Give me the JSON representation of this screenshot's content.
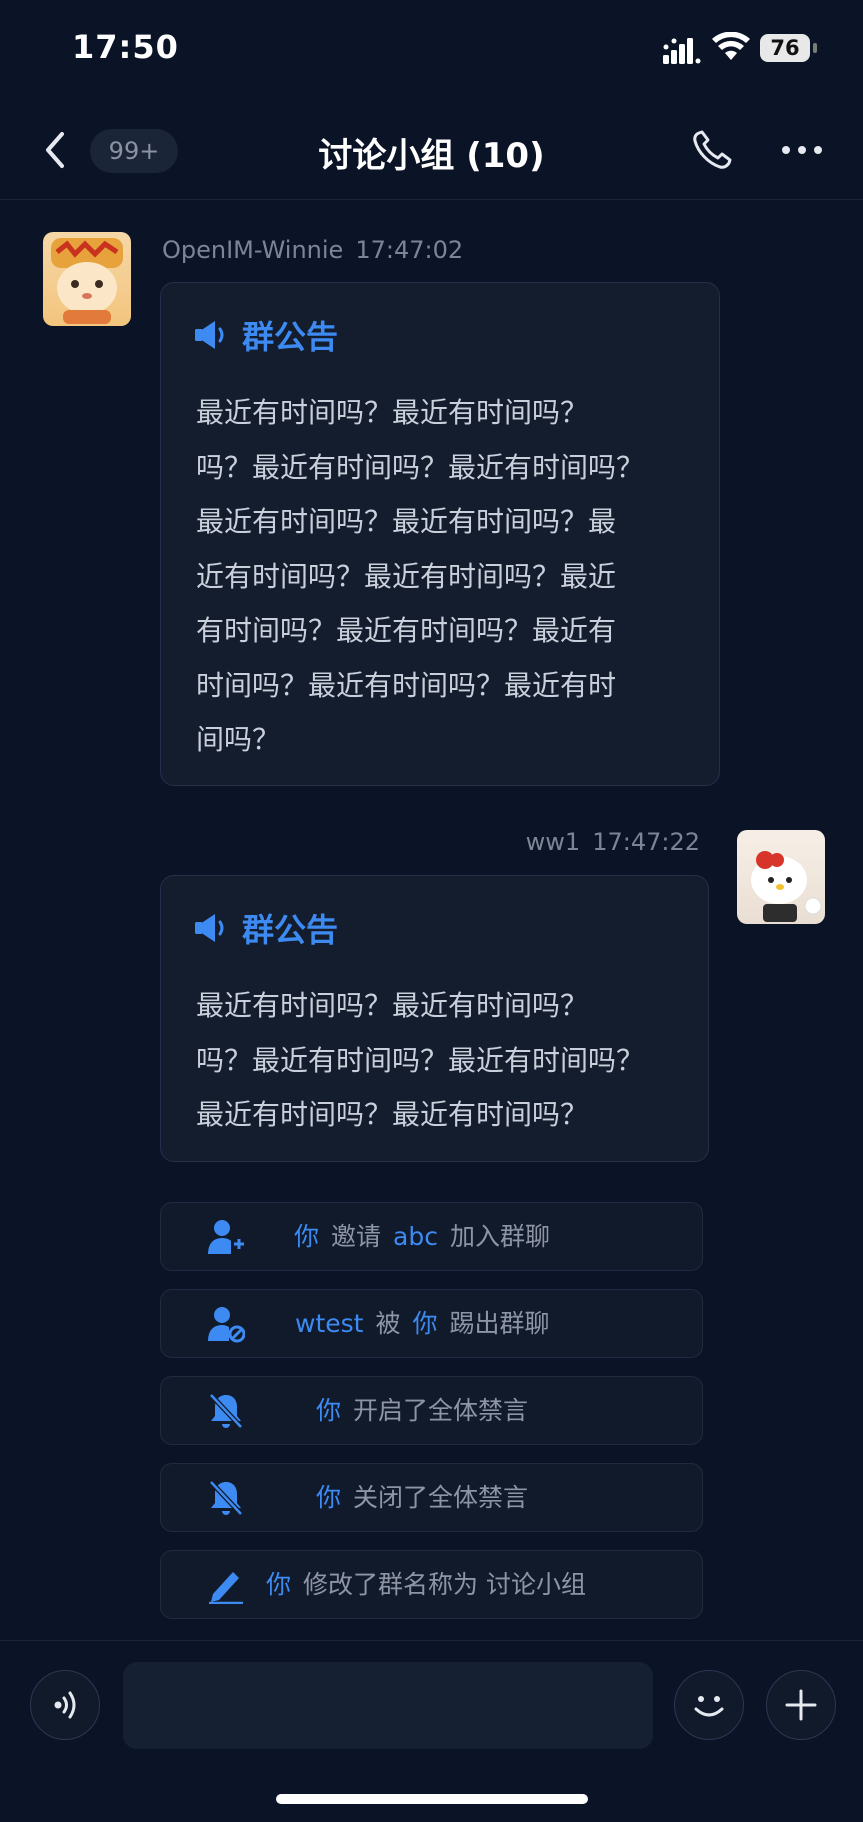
{
  "status_bar": {
    "time": "17:50",
    "battery": "76"
  },
  "nav": {
    "unread_badge": "99+",
    "title": "讨论小组 (10)"
  },
  "messages": [
    {
      "sender": "OpenIM-Winnie",
      "time": "17:47:02",
      "notice_label": "群公告",
      "notice_text": "最近有时间吗？最近有时间吗？\n吗？最近有时间吗？最近有时间吗？\n最近有时间吗？最近有时间吗？最\n近有时间吗？最近有时间吗？最近\n有时间吗？最近有时间吗？最近有\n时间吗？最近有时间吗？最近有时\n间吗？"
    },
    {
      "sender": "ww1",
      "time": "17:47:22",
      "notice_label": "群公告",
      "notice_text": "最近有时间吗？最近有时间吗？\n吗？最近有时间吗？最近有时间吗？\n最近有时间吗？最近有时间吗？"
    }
  ],
  "system_notices": [
    {
      "icon": "user-add-icon",
      "actor": "你",
      "verb": "邀请",
      "target": "abc",
      "suffix": "加入群聊"
    },
    {
      "icon": "user-remove-icon",
      "actor": "wtest",
      "verb": "被",
      "target": "你",
      "suffix": "踢出群聊"
    },
    {
      "icon": "bell-off-icon",
      "actor": "你",
      "suffix": "开启了全体禁言"
    },
    {
      "icon": "bell-off-icon",
      "actor": "你",
      "suffix": "关闭了全体禁言"
    },
    {
      "icon": "edit-icon",
      "actor": "你",
      "suffix": "修改了群名称为 讨论小组"
    }
  ],
  "colors": {
    "accent": "#3d8bf2",
    "background": "#0b1426",
    "card": "#141d2e"
  }
}
